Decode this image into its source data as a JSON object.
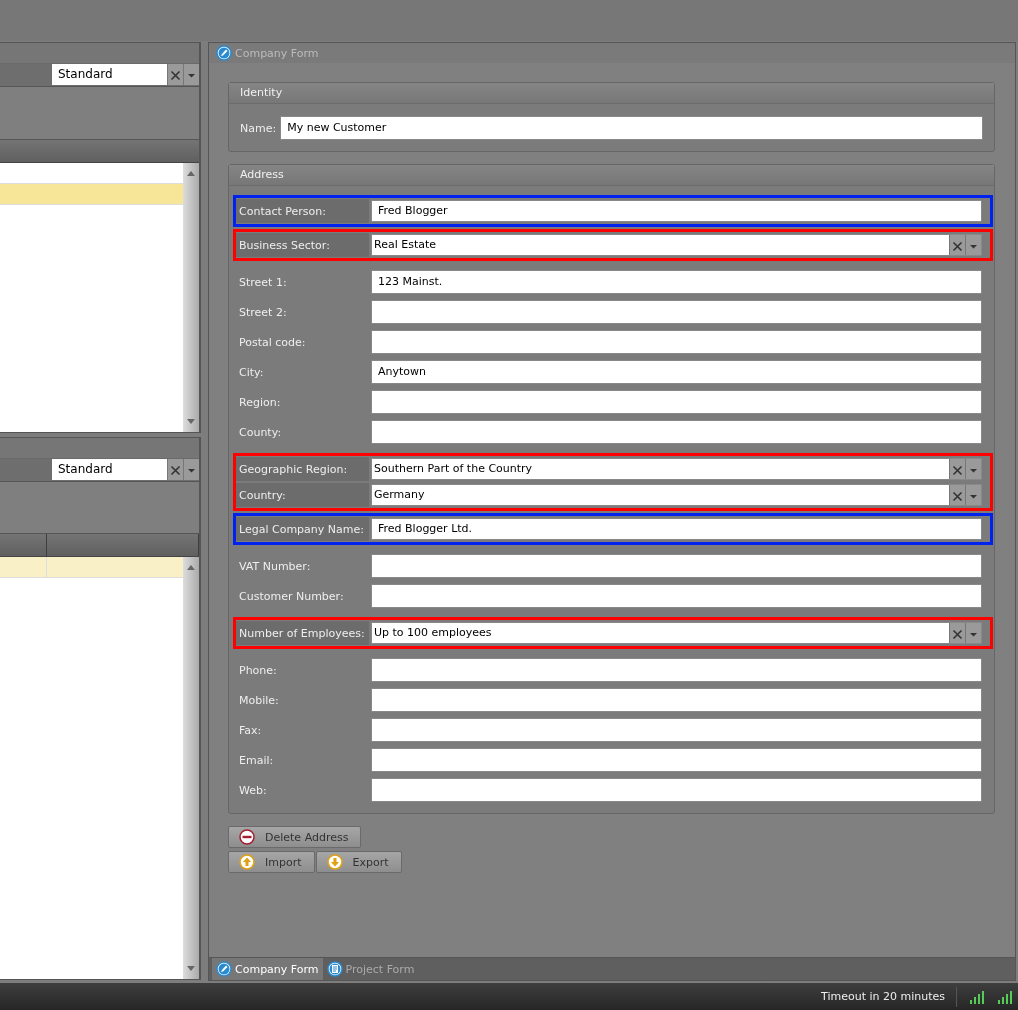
{
  "left_panels": [
    {
      "focused": true,
      "kind": "single",
      "view": "Standard",
      "rows": [
        {
          "selected": false
        },
        {
          "selected": true
        }
      ]
    },
    {
      "focused": false,
      "kind": "split",
      "view": "Standard",
      "rows": [
        {
          "selected": true
        }
      ]
    }
  ],
  "form": {
    "title": "Company Form",
    "identity": {
      "title": "Identity",
      "name_label": "Name:",
      "name_value": "My new Customer"
    },
    "address": {
      "title": "Address",
      "groups": [
        {
          "color": "#0022ee",
          "fields": [
            {
              "kind": "text",
              "label": "Contact Person:",
              "value": "Fred Blogger"
            }
          ]
        },
        {
          "color": "#ff0000",
          "fields": [
            {
              "kind": "combo",
              "label": "Business Sector:",
              "value": "Real Estate"
            }
          ]
        },
        {
          "fields": [
            {
              "kind": "text",
              "label": "Street 1:",
              "value": "123 Mainst."
            },
            {
              "kind": "text",
              "label": "Street 2:"
            },
            {
              "kind": "text",
              "label": "Postal code:"
            },
            {
              "kind": "text",
              "label": "City:",
              "value": "Anytown"
            },
            {
              "kind": "text",
              "label": "Region:"
            },
            {
              "kind": "text",
              "label": "County:"
            }
          ]
        },
        {
          "color": "#ff0000",
          "fields": [
            {
              "kind": "combo",
              "label": "Geographic Region:",
              "value": "Southern Part of the Country"
            },
            {
              "kind": "combo",
              "label": "Country:",
              "value": "Germany"
            }
          ]
        },
        {
          "color": "#0022ee",
          "fields": [
            {
              "kind": "text",
              "label": "Legal Company Name:",
              "value": "Fred Blogger Ltd."
            }
          ]
        },
        {
          "fields": [
            {
              "kind": "text",
              "label": "VAT Number:"
            },
            {
              "kind": "text",
              "label": "Customer Number:"
            }
          ]
        },
        {
          "color": "#ff0000",
          "fields": [
            {
              "kind": "combo",
              "label": "Number of Employees:",
              "value": "Up to 100 employees"
            }
          ]
        },
        {
          "fields": [
            {
              "kind": "text",
              "label": "Phone:"
            },
            {
              "kind": "text",
              "label": "Mobile:"
            },
            {
              "kind": "text",
              "label": "Fax:"
            },
            {
              "kind": "text",
              "label": "Email:"
            },
            {
              "kind": "text",
              "label": "Web:"
            }
          ]
        }
      ]
    },
    "button_rows": [
      [
        {
          "kind": "delete",
          "label": "Delete Address"
        }
      ],
      [
        {
          "kind": "import",
          "label": "Import"
        },
        {
          "kind": "export",
          "label": "Export"
        }
      ]
    ],
    "tabs": [
      {
        "kind": "company",
        "label": "Company Form",
        "selected": true
      },
      {
        "kind": "project",
        "label": "Project Form",
        "selected": false
      }
    ]
  },
  "status_bar": {
    "text": "Timeout in 20 minutes"
  }
}
